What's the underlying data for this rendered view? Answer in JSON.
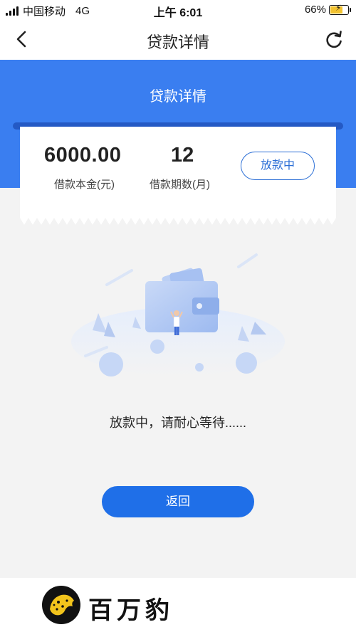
{
  "status_bar": {
    "carrier": "中国移动",
    "network": "4G",
    "time": "上午 6:01",
    "battery": "66%"
  },
  "nav": {
    "title": "贷款详情",
    "back_icon": "chevron-left-icon",
    "refresh_icon": "refresh-icon"
  },
  "hero": {
    "title": "贷款详情"
  },
  "loan": {
    "amount": "6000.00",
    "amount_label": "借款本金(元)",
    "term": "12",
    "term_label": "借款期数(月)",
    "status": "放款中"
  },
  "illustration": {
    "icon": "wallet-illustration"
  },
  "message": "放款中，请耐心等待......",
  "actions": {
    "back_label": "返回"
  },
  "footer": {
    "brand": "百万豹"
  },
  "colors": {
    "primary": "#3a7ef0",
    "button": "#1f6fe8",
    "status_border": "#2c6fd6",
    "background": "#f3f3f3"
  }
}
